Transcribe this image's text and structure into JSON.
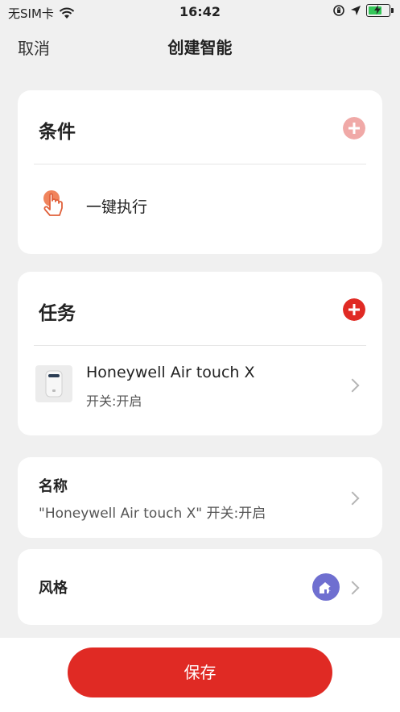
{
  "status": {
    "carrier": "无SIM卡",
    "time": "16:42"
  },
  "nav": {
    "cancel": "取消",
    "title": "创建智能"
  },
  "conditions": {
    "title": "条件",
    "item_label": "一键执行"
  },
  "tasks": {
    "title": "任务",
    "device_name": "Honeywell Air touch X",
    "device_action": "开关:开启"
  },
  "name_card": {
    "label": "名称",
    "value": "\"Honeywell Air touch X\" 开关:开启"
  },
  "style_card": {
    "label": "风格"
  },
  "save": {
    "label": "保存"
  },
  "colors": {
    "accent": "#e02a24",
    "disabled_plus": "#f0a9a7",
    "style_badge": "#6f6fd0"
  }
}
